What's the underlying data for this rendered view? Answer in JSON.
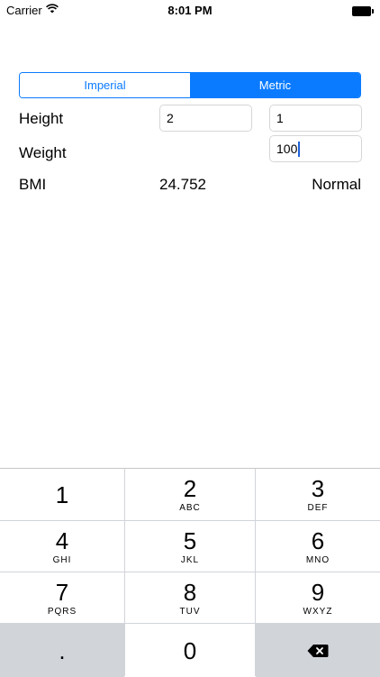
{
  "status_bar": {
    "carrier": "Carrier",
    "time": "8:01 PM",
    "wifi_icon": "wifi-icon",
    "battery_icon": "battery-icon"
  },
  "segmented_control": {
    "options": [
      "Imperial",
      "Metric"
    ],
    "selected": "Metric"
  },
  "form": {
    "height_label": "Height",
    "height_value_1": "2",
    "height_value_2": "1",
    "weight_label": "Weight",
    "weight_value": "100"
  },
  "result": {
    "bmi_label": "BMI",
    "bmi_value": "24.752",
    "category": "Normal"
  },
  "keypad": {
    "keys": [
      {
        "digit": "1",
        "letters": ""
      },
      {
        "digit": "2",
        "letters": "ABC"
      },
      {
        "digit": "3",
        "letters": "DEF"
      },
      {
        "digit": "4",
        "letters": "GHI"
      },
      {
        "digit": "5",
        "letters": "JKL"
      },
      {
        "digit": "6",
        "letters": "MNO"
      },
      {
        "digit": "7",
        "letters": "PQRS"
      },
      {
        "digit": "8",
        "letters": "TUV"
      },
      {
        "digit": "9",
        "letters": "WXYZ"
      }
    ],
    "decimal": ".",
    "zero": "0",
    "backspace_icon": "backspace-icon"
  }
}
